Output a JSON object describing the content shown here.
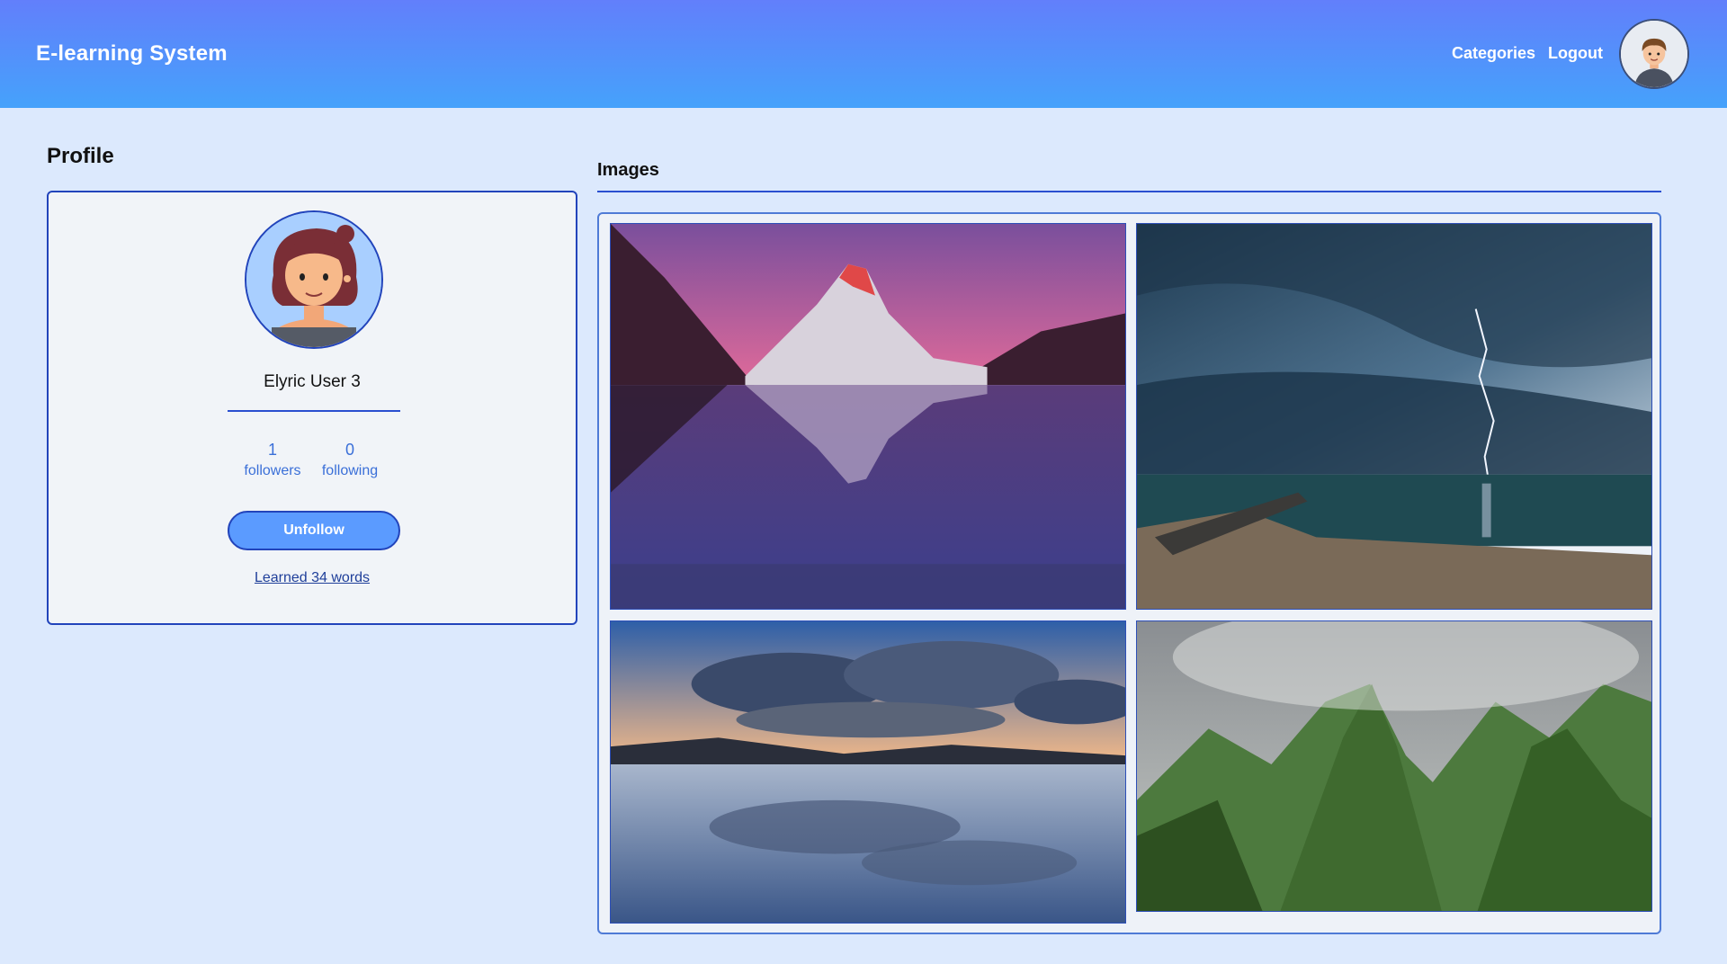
{
  "app": {
    "title": "E-learning System"
  },
  "nav": {
    "categories_label": "Categories",
    "logout_label": "Logout",
    "avatar_icon": "male-avatar-icon"
  },
  "profile": {
    "heading": "Profile",
    "avatar_icon": "female-avatar-icon",
    "username": "Elyric User 3",
    "followers_count": "1",
    "followers_label": "followers",
    "following_count": "0",
    "following_label": "following",
    "unfollow_label": "Unfollow",
    "learned_link": "Learned 34 words"
  },
  "images": {
    "heading": "Images",
    "items": [
      {
        "subject": "mountain-lake-reflection"
      },
      {
        "subject": "lightning-storm-beach"
      },
      {
        "subject": "sunset-clouds-reflection"
      },
      {
        "subject": "green-mountain-peaks"
      }
    ]
  },
  "colors": {
    "nav_gradient_top": "#627ffb",
    "nav_gradient_bottom": "#45a2fb",
    "page_bg": "#dce9fd",
    "accent": "#2244bb",
    "button_bg": "#5b9bff",
    "stat_text": "#3a6fd8"
  }
}
